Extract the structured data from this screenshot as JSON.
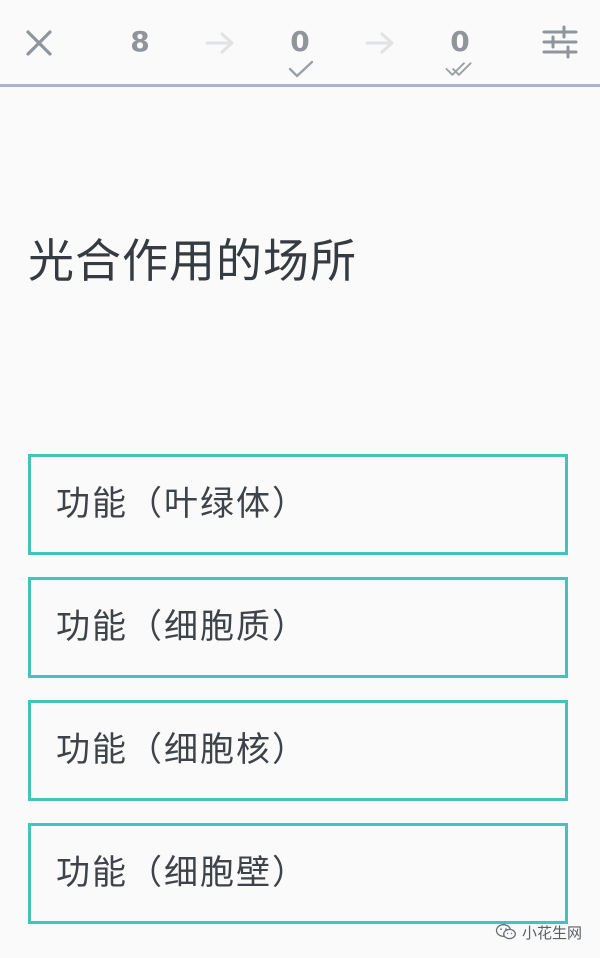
{
  "header": {
    "counters": {
      "total": "8",
      "correct": "0",
      "mastered": "0"
    },
    "icons": {
      "close": "close-icon",
      "arrow": "arrow-right-icon",
      "check": "check-icon",
      "double_check": "double-check-icon",
      "settings": "sliders-icon"
    },
    "divider_color": "#aeb0d0"
  },
  "question": {
    "text": "光合作用的场所"
  },
  "options": [
    {
      "label": "功能（叶绿体）"
    },
    {
      "label": "功能（细胞质）"
    },
    {
      "label": "功能（细胞核）"
    },
    {
      "label": "功能（细胞壁）"
    }
  ],
  "theme": {
    "accent": "#40c4bc",
    "text": "#353b40",
    "muted": "#8f959a",
    "background": "#fafafa"
  },
  "watermark": {
    "text": "小花生网",
    "icon": "wechat-icon"
  }
}
